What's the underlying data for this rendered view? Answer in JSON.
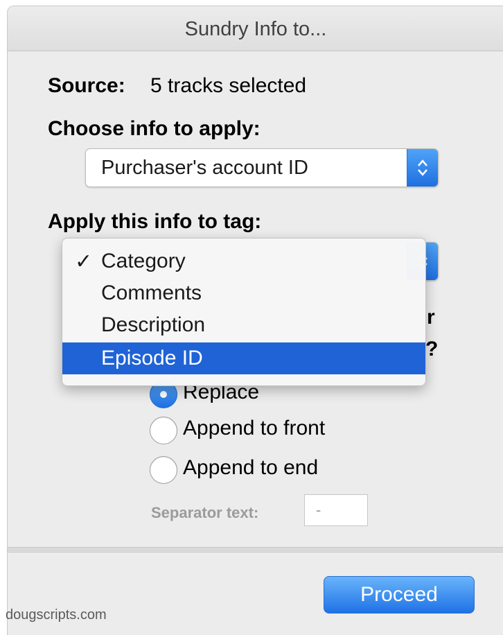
{
  "window": {
    "title": "Sundry Info to..."
  },
  "source": {
    "label": "Source:",
    "value": "5 tracks selected"
  },
  "choose_info": {
    "label": "Choose info to apply:",
    "selected": "Purchaser's account ID"
  },
  "apply_tag": {
    "label": "Apply this info to tag:",
    "menu_items": [
      {
        "label": "Category",
        "checked": true,
        "highlighted": false
      },
      {
        "label": "Comments",
        "checked": false,
        "highlighted": false
      },
      {
        "label": "Description",
        "checked": false,
        "highlighted": false
      },
      {
        "label": "Episode ID",
        "checked": false,
        "highlighted": true
      }
    ],
    "check_glyph": "✓"
  },
  "hidden_fragments": {
    "r_char": "r",
    "q_char": "?"
  },
  "mode": {
    "options": [
      {
        "label": "Replace",
        "selected": true
      },
      {
        "label": "Append to front",
        "selected": false
      },
      {
        "label": "Append to end",
        "selected": false
      }
    ]
  },
  "separator": {
    "label": "Separator text:",
    "value": "-"
  },
  "buttons": {
    "proceed": "Proceed"
  },
  "footer": {
    "credit": "dougscripts.com"
  },
  "colors": {
    "accent": "#1f63d6",
    "window_bg": "#ececec"
  }
}
